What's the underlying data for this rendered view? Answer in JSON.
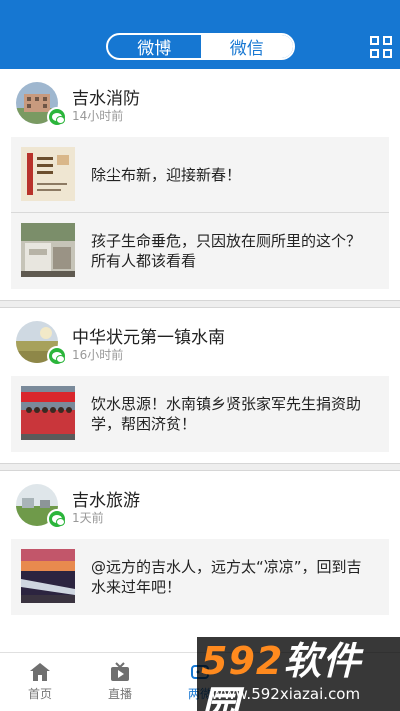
{
  "header": {
    "tabs": [
      {
        "label": "微博",
        "active": false
      },
      {
        "label": "微信",
        "active": true
      }
    ],
    "menu_icon": "grid-icon",
    "accent": "#1677d2"
  },
  "feed": [
    {
      "source": "吉水消防",
      "time": "14小时前",
      "articles": [
        {
          "title": "除尘布新，迎接新春！"
        },
        {
          "title": "孩子生命垂危，只因放在厕所里的这个？所有人都该看看"
        }
      ]
    },
    {
      "source": "中华状元第一镇水南",
      "time": "16小时前",
      "articles": [
        {
          "title": "饮水思源！水南镇乡贤张家军先生捐资助学，帮困济贫！"
        }
      ]
    },
    {
      "source": "吉水旅游",
      "time": "1天前",
      "articles": [
        {
          "title": "@远方的吉水人，远方太“凉凉”，回到吉水来过年吧！"
        }
      ]
    }
  ],
  "tabbar": {
    "items": [
      {
        "label": "首页",
        "icon": "home-icon"
      },
      {
        "label": "直播",
        "icon": "tv-icon"
      },
      {
        "label": "两微",
        "icon": "weibo-weixin-icon",
        "active": true
      }
    ]
  },
  "watermark": {
    "brand_num": "592",
    "brand_text": "软件园",
    "url": "www.592xiazai.com"
  }
}
